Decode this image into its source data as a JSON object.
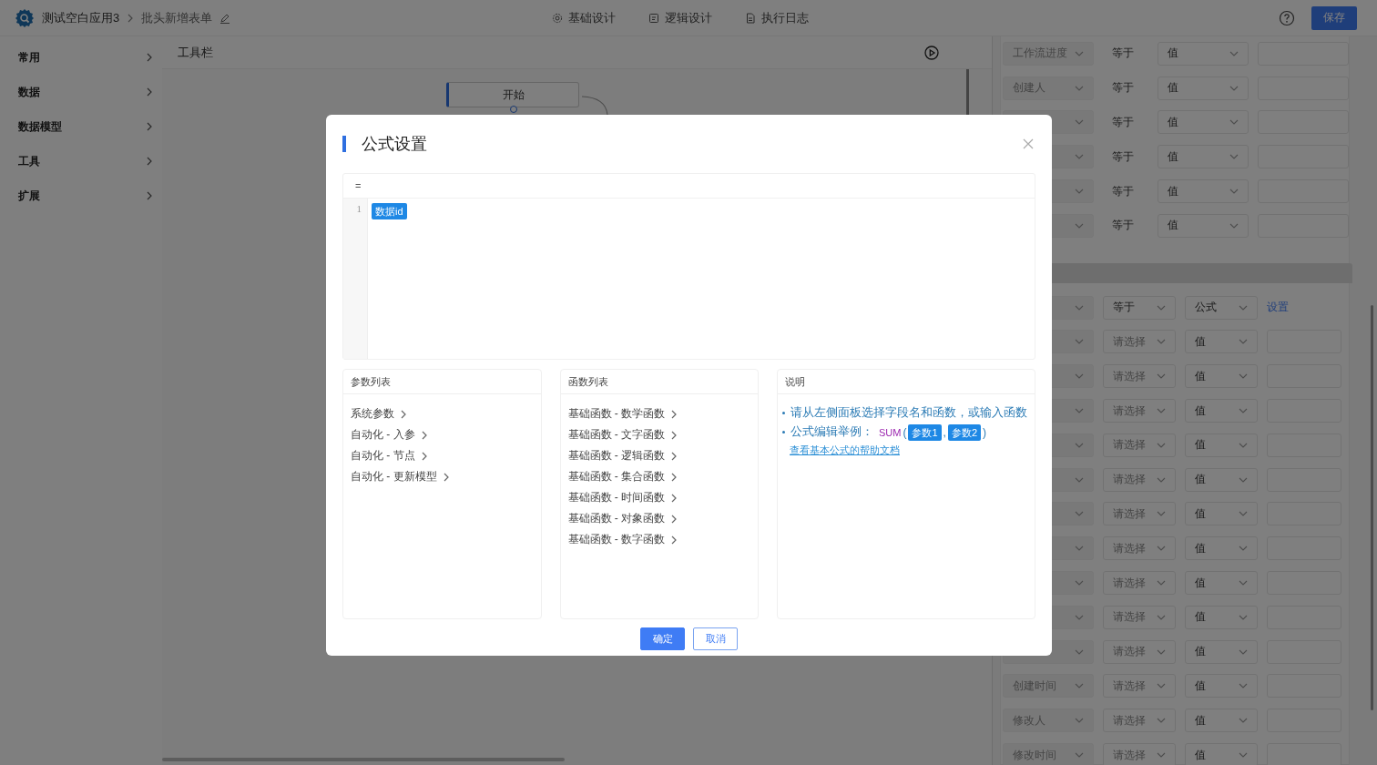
{
  "header": {
    "app_name": "测试空白应用3",
    "page_name": "批头新增表单",
    "tabs": [
      {
        "label": "基础设计",
        "kind": "gear"
      },
      {
        "label": "逻辑设计",
        "kind": "logic"
      },
      {
        "label": "执行日志",
        "kind": "log"
      }
    ],
    "save_button": "保存"
  },
  "sidebar": {
    "items": [
      {
        "label": "常用"
      },
      {
        "label": "数据"
      },
      {
        "label": "数据模型"
      },
      {
        "label": "工具"
      },
      {
        "label": "扩展"
      }
    ]
  },
  "canvas": {
    "toolbar_title": "工具栏",
    "nodes": [
      {
        "label": "开始"
      }
    ]
  },
  "conditions": {
    "top_rows": [
      {
        "field": "工作流进度",
        "operator": "等于",
        "value_type": "值"
      },
      {
        "field": "创建人",
        "operator": "等于",
        "value_type": "值"
      },
      {
        "operator": "等于",
        "value_type": "值"
      },
      {
        "operator": "等于",
        "value_type": "值"
      },
      {
        "operator": "等于",
        "value_type": "值"
      },
      {
        "operator": "等于",
        "value_type": "值"
      }
    ],
    "lower_rows": [
      {
        "kind": "formula",
        "operator": "等于",
        "value_type": "公式",
        "link": "设置"
      },
      {
        "kind": "value",
        "operator_placeholder": "请选择",
        "value_type": "值"
      },
      {
        "kind": "value",
        "operator_placeholder": "请选择",
        "value_type": "值"
      },
      {
        "kind": "value",
        "operator_placeholder": "请选择",
        "value_type": "值"
      },
      {
        "kind": "value",
        "operator_placeholder": "请选择",
        "value_type": "值"
      },
      {
        "kind": "value",
        "operator_placeholder": "请选择",
        "value_type": "值"
      },
      {
        "kind": "value",
        "operator_placeholder": "请选择",
        "value_type": "值"
      },
      {
        "kind": "value",
        "operator_placeholder": "请选择",
        "value_type": "值"
      },
      {
        "kind": "value",
        "operator_placeholder": "请选择",
        "value_type": "值"
      },
      {
        "kind": "value",
        "operator_placeholder": "请选择",
        "value_type": "值"
      },
      {
        "kind": "value",
        "operator_placeholder": "请选择",
        "value_type": "值"
      },
      {
        "kind": "value",
        "field": "创建时间",
        "operator_placeholder": "请选择",
        "value_type": "值"
      },
      {
        "kind": "value",
        "field": "修改人",
        "operator_placeholder": "请选择",
        "value_type": "值"
      },
      {
        "kind": "value",
        "field": "修改时间",
        "operator_placeholder": "请选择",
        "value_type": "值"
      }
    ]
  },
  "modal": {
    "title": "公式设置",
    "editor": {
      "prefix": "=",
      "lines": [
        {
          "number": "1",
          "tokens": [
            {
              "kind": "field",
              "text": "数据id"
            }
          ]
        }
      ]
    },
    "panels": [
      {
        "kind": "list",
        "title": "参数列表",
        "items": [
          "系统参数",
          "自动化 - 入参",
          "自动化 - 节点",
          "自动化 - 更新模型"
        ]
      },
      {
        "kind": "list",
        "title": "函数列表",
        "items": [
          "基础函数 - 数学函数",
          "基础函数 - 文字函数",
          "基础函数 - 逻辑函数",
          "基础函数 - 集合函数",
          "基础函数 - 时间函数",
          "基础函数 - 对象函数",
          "基础函数 - 数字函数"
        ]
      },
      {
        "kind": "help",
        "title": "说明",
        "bullets": [
          {
            "kind": "text",
            "text": "请从左侧面板选择字段名和函数，或输入函数"
          },
          {
            "kind": "example",
            "label": "公式编辑举例：",
            "function": "SUM",
            "open": "(",
            "args": [
              "参数1",
              "参数2"
            ],
            "separator": ",",
            "close": ")"
          }
        ],
        "link": "查看基本公式的帮助文档"
      }
    ],
    "buttons": [
      {
        "label": "确定",
        "kind": "primary"
      },
      {
        "label": "取消",
        "kind": "default"
      }
    ]
  }
}
